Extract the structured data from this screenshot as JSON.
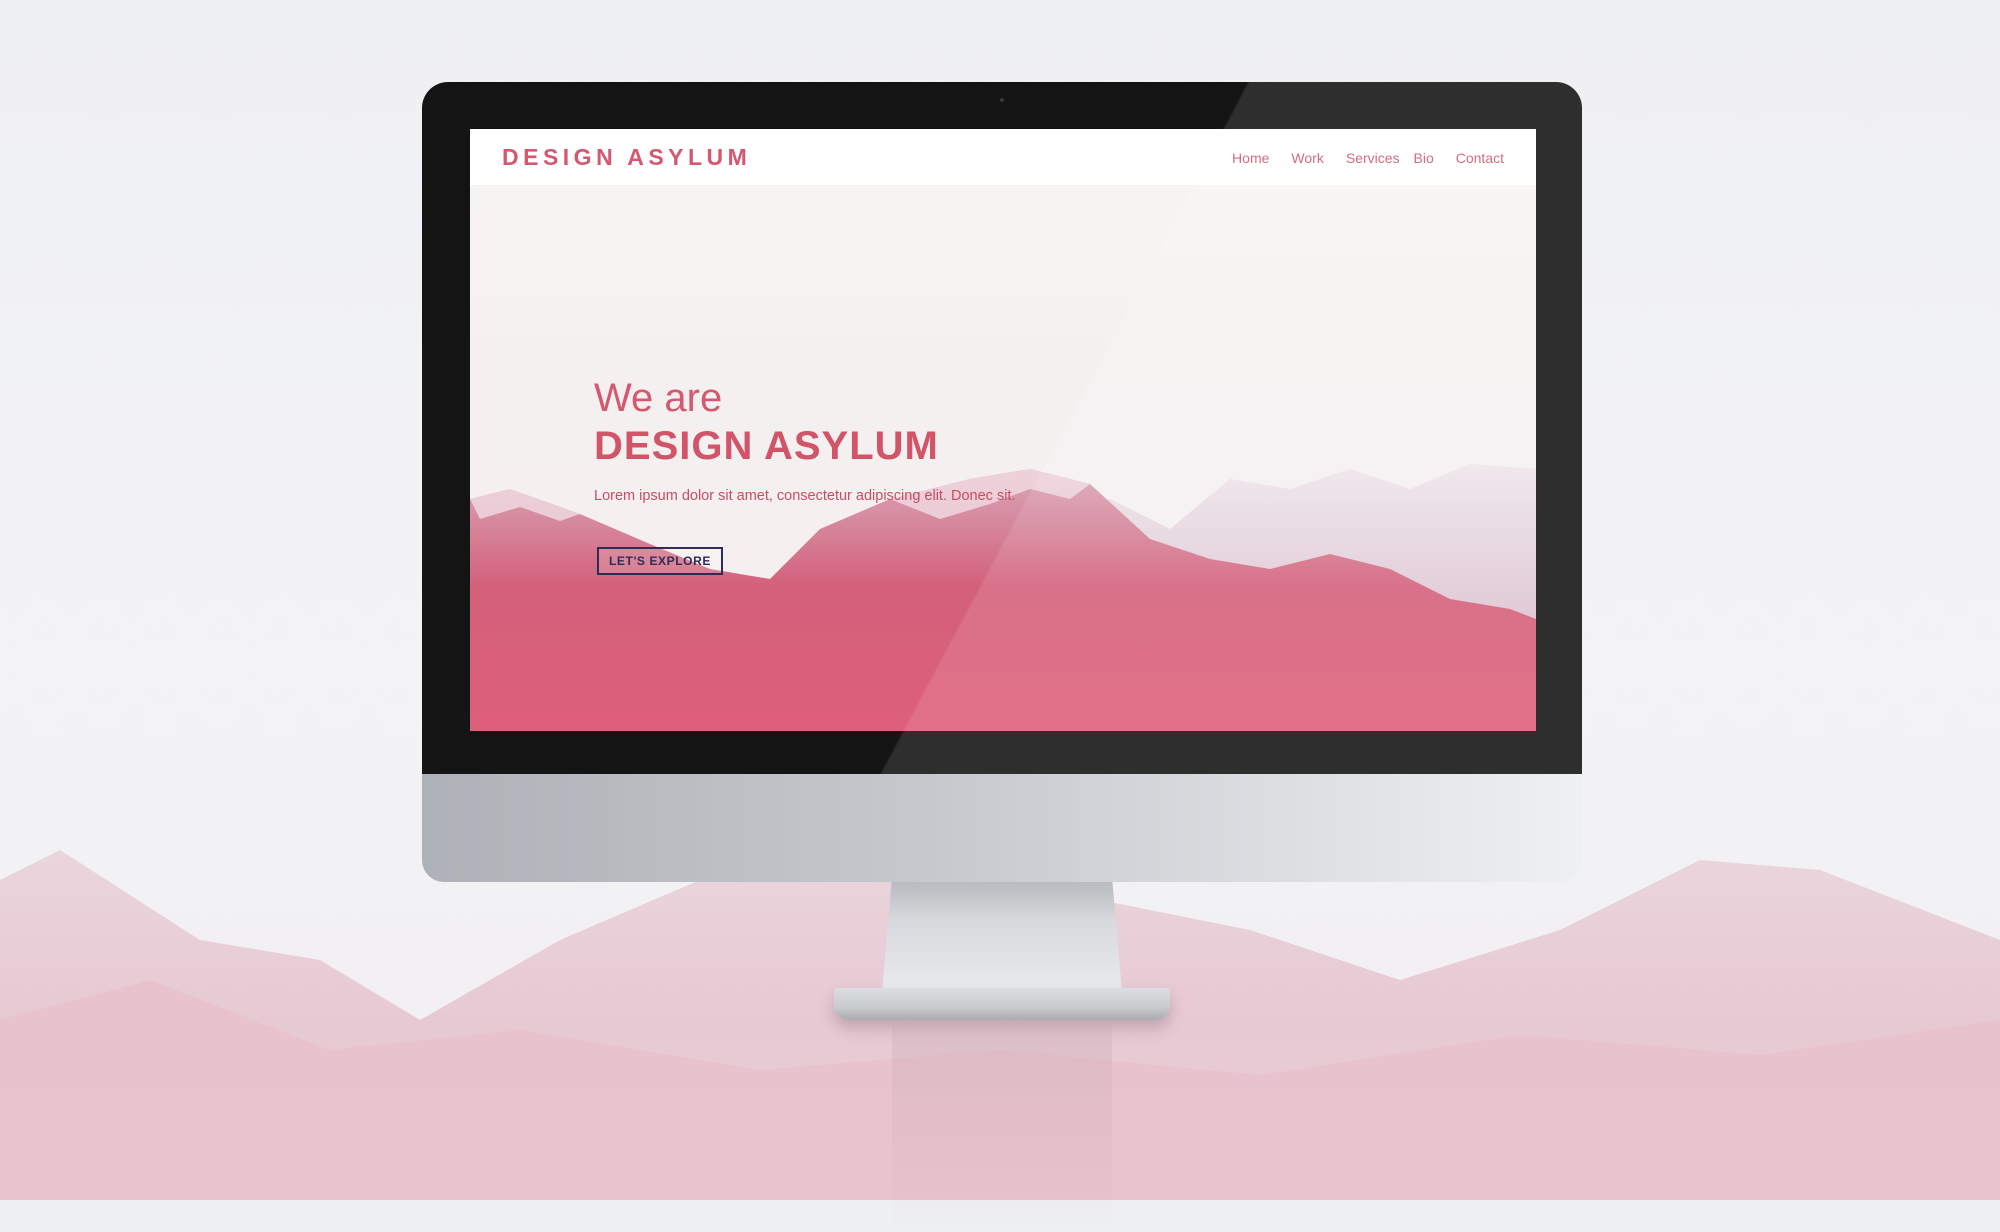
{
  "site": {
    "logo": "DESIGN ASYLUM",
    "nav": [
      "Home",
      "Work",
      "Services",
      "Bio",
      "Contact"
    ],
    "hero": {
      "line1": "We are",
      "line2": "DESIGN ASYLUM",
      "subtitle": "Lorem ipsum dolor sit amet, consectetur adipiscing elit. Donec sit.",
      "cta": "LET'S EXPLORE"
    }
  },
  "colors": {
    "accent": "#d45870",
    "button_border": "#2e2c55",
    "bezel": "#141414",
    "mountain": "#d65a78"
  }
}
